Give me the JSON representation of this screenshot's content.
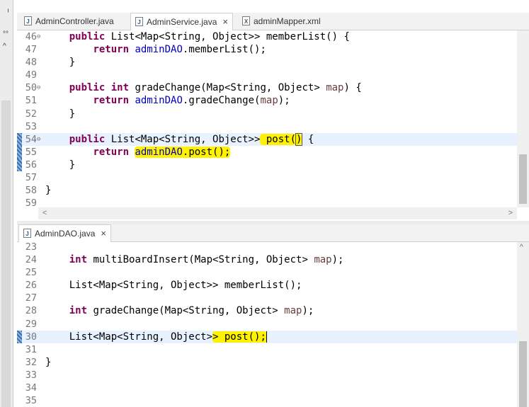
{
  "left_strip": {
    "label1": "ᅵ",
    "label2": "°°",
    "chevron": "^"
  },
  "top_editor": {
    "tabs": [
      {
        "label": "AdminController.java",
        "icon": "J"
      },
      {
        "label": "AdminService.java",
        "icon": "J",
        "close": "×"
      },
      {
        "label": "adminMapper.xml",
        "icon": "X"
      }
    ],
    "lines": [
      {
        "n": "46",
        "fold": "⊖"
      },
      {
        "n": "47"
      },
      {
        "n": "48"
      },
      {
        "n": "49"
      },
      {
        "n": "50",
        "fold": "⊖"
      },
      {
        "n": "51"
      },
      {
        "n": "52"
      },
      {
        "n": "53"
      },
      {
        "n": "54",
        "fold": "⊖"
      },
      {
        "n": "55"
      },
      {
        "n": "56"
      },
      {
        "n": "57"
      },
      {
        "n": "58"
      },
      {
        "n": "59"
      }
    ],
    "code": {
      "l46": {
        "kw1": "public",
        "t1": " List<Map<String, Object>> memberList() {"
      },
      "l47": {
        "kw1": "return",
        "fld": "adminDAO",
        "t1": ".memberList();"
      },
      "l48": {
        "t1": "}"
      },
      "l50": {
        "kw1": "public",
        "kw2": "int",
        "t1": " gradeChange(Map<String, Object> ",
        "prm": "map",
        "t2": ") {"
      },
      "l51": {
        "kw1": "return",
        "fld": "adminDAO",
        "t1": ".gradeChange(",
        "prm": "map",
        "t2": ");"
      },
      "l52": {
        "t1": "}"
      },
      "l54": {
        "kw1": "public",
        "t1": " List<Map<String, Object>>",
        "hl1": " post(",
        "hl2": ")",
        "t2": " {"
      },
      "l55": {
        "kw1": "return",
        "fld": "adminDAO",
        "t1": ".post();"
      },
      "l56": {
        "t1": "}"
      },
      "l58": {
        "t1": "}"
      }
    },
    "scroll_left": "<",
    "scroll_right": ">"
  },
  "bottom_editor": {
    "tab": {
      "label": "AdminDAO.java",
      "icon": "J",
      "close": "×"
    },
    "lines": [
      {
        "n": "23"
      },
      {
        "n": "24"
      },
      {
        "n": "25"
      },
      {
        "n": "26"
      },
      {
        "n": "27"
      },
      {
        "n": "28"
      },
      {
        "n": "29"
      },
      {
        "n": "30"
      },
      {
        "n": "31"
      },
      {
        "n": "32"
      },
      {
        "n": "33"
      },
      {
        "n": "34"
      },
      {
        "n": "35"
      }
    ],
    "code": {
      "l24": {
        "kw1": "int",
        "t1": " multiBoardInsert(Map<String, Object> ",
        "prm": "map",
        "t2": ");"
      },
      "l26": {
        "t1": "List<Map<String, Object>> memberList();"
      },
      "l28": {
        "kw1": "int",
        "t1": " gradeChange(Map<String, Object> ",
        "prm": "map",
        "t2": ");"
      },
      "l30": {
        "t1": "List<Map<String, Object>",
        "hl": "> post();"
      },
      "l32": {
        "t1": "}"
      }
    }
  }
}
